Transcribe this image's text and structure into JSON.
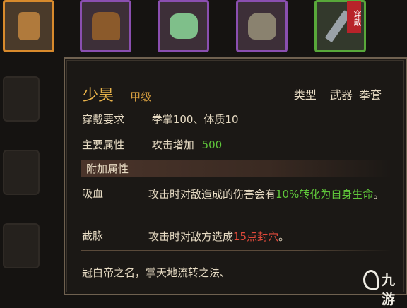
{
  "slots": [
    {
      "icon": "gauntlet-icon",
      "border": "orange"
    },
    {
      "icon": "leather-armor-icon",
      "border": "purple"
    },
    {
      "icon": "jade-stone-icon",
      "border": "purple"
    },
    {
      "icon": "sack-icon",
      "border": "purple"
    },
    {
      "icon": "sword-icon",
      "border": "green",
      "equipped_tag": "穿戴"
    }
  ],
  "tooltip": {
    "name": "少昊",
    "grade": "甲级",
    "type_label": "类型",
    "type_value1": "武器",
    "type_value2": "拳套",
    "req_label": "穿戴要求",
    "req_value": "拳掌100、体质10",
    "main_label": "主要属性",
    "main_text": "攻击增加",
    "main_value": "500",
    "extra_header": "附加属性",
    "affix1_label": "吸血",
    "affix1_text": "攻击时对敌造成的伤害会有",
    "affix1_green": "10%转化为自身生命",
    "affix1_end": "。",
    "affix2_label": "截脉",
    "affix2_text": "攻击时对敌方造成",
    "affix2_red": "15点封穴",
    "affix2_end": "。",
    "flavor": "冠白帝之名，掌天地流转之法、"
  },
  "watermark": {
    "text": "九游"
  },
  "colors": {
    "legendary": "#d88a2c",
    "epic": "#8a4fb0",
    "uncommon": "#58a83a",
    "name": "#e8b24a",
    "positive": "#5fc63a",
    "negative": "#e24a3a"
  }
}
